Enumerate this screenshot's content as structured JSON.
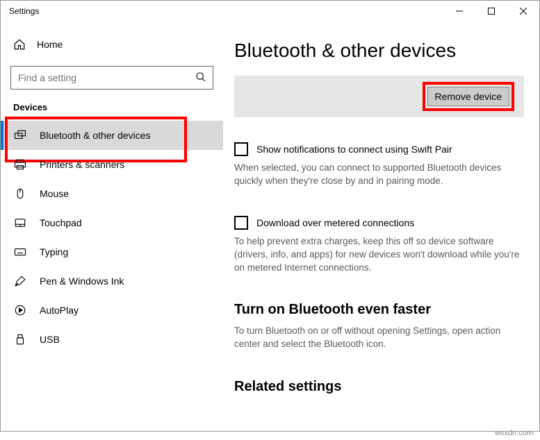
{
  "window_title": "Settings",
  "home_label": "Home",
  "search_placeholder": "Find a setting",
  "section_header": "Devices",
  "nav": [
    {
      "label": "Bluetooth & other devices"
    },
    {
      "label": "Printers & scanners"
    },
    {
      "label": "Mouse"
    },
    {
      "label": "Touchpad"
    },
    {
      "label": "Typing"
    },
    {
      "label": "Pen & Windows Ink"
    },
    {
      "label": "AutoPlay"
    },
    {
      "label": "USB"
    }
  ],
  "main": {
    "title": "Bluetooth & other devices",
    "remove_button": "Remove device",
    "swift_pair_label": "Show notifications to connect using Swift Pair",
    "swift_pair_help": "When selected, you can connect to supported Bluetooth devices quickly when they're close by and in pairing mode.",
    "metered_label": "Download over metered connections",
    "metered_help": "To help prevent extra charges, keep this off so device software (drivers, info, and apps) for new devices won't download while you're on metered Internet connections.",
    "faster_head": "Turn on Bluetooth even faster",
    "faster_help": "To turn Bluetooth on or off without opening Settings, open action center and select the Bluetooth icon.",
    "related_head": "Related settings"
  },
  "watermark": "wsxdn.com"
}
